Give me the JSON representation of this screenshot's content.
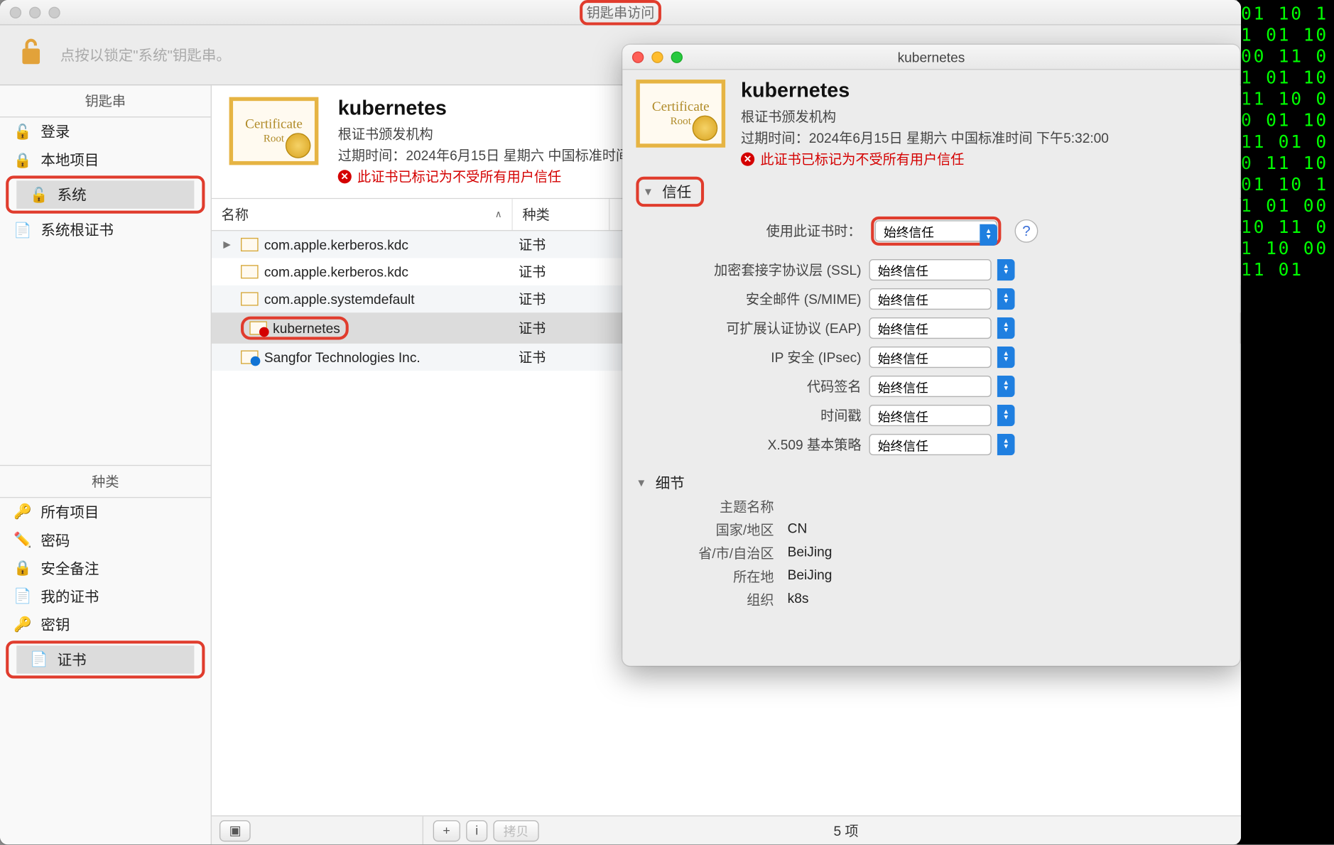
{
  "window": {
    "title": "钥匙串访问",
    "lock_hint": "点按以锁定\"系统\"钥匙串。"
  },
  "sidebar": {
    "keychains": {
      "header": "钥匙串",
      "items": [
        {
          "label": "登录",
          "icon": "🔓"
        },
        {
          "label": "本地项目",
          "icon": "🔒"
        },
        {
          "label": "系统",
          "icon": "🔓",
          "selected": true,
          "highlight": true
        },
        {
          "label": "系统根证书",
          "icon": "📄"
        }
      ]
    },
    "categories": {
      "header": "种类",
      "items": [
        {
          "label": "所有项目",
          "icon": "🔑"
        },
        {
          "label": "密码",
          "icon": "✏️"
        },
        {
          "label": "安全备注",
          "icon": "🔒"
        },
        {
          "label": "我的证书",
          "icon": "📄"
        },
        {
          "label": "密钥",
          "icon": "🔑"
        },
        {
          "label": "证书",
          "icon": "📄",
          "selected": true,
          "highlight": true
        }
      ]
    }
  },
  "cert_header": {
    "title": "kubernetes",
    "subtitle": "根证书颁发机构",
    "expiry": "过期时间：2024年6月15日 星期六 中国标准时间 下午5:32:00",
    "error": "此证书已标记为不受所有用户信任"
  },
  "columns": {
    "name": "名称",
    "kind": "种类"
  },
  "rows": [
    {
      "name": "com.apple.kerberos.kdc",
      "kind": "证书",
      "expand": true
    },
    {
      "name": "com.apple.kerberos.kdc",
      "kind": "证书"
    },
    {
      "name": "com.apple.systemdefault",
      "kind": "证书"
    },
    {
      "name": "kubernetes",
      "kind": "证书",
      "selected": true,
      "highlight": true,
      "badge": "red"
    },
    {
      "name": "Sangfor Technologies Inc.",
      "kind": "证书",
      "badge": "blue"
    }
  ],
  "statusbar": {
    "copy": "拷贝",
    "count": "5 项",
    "plus": "+",
    "info": "i"
  },
  "detail": {
    "title": "kubernetes",
    "trust_section": "信任",
    "details_section": "细节",
    "use_label": "使用此证书时：",
    "trust_value": "始终信任",
    "trust_rows": [
      {
        "label": "加密套接字协议层 (SSL)",
        "value": "始终信任"
      },
      {
        "label": "安全邮件 (S/MIME)",
        "value": "始终信任"
      },
      {
        "label": "可扩展认证协议 (EAP)",
        "value": "始终信任"
      },
      {
        "label": "IP 安全 (IPsec)",
        "value": "始终信任"
      },
      {
        "label": "代码签名",
        "value": "始终信任"
      },
      {
        "label": "时间戳",
        "value": "始终信任"
      },
      {
        "label": "X.509 基本策略",
        "value": "始终信任"
      }
    ],
    "subject_heading": "主题名称",
    "kv": [
      {
        "k": "国家/地区",
        "v": "CN"
      },
      {
        "k": "省/市/自治区",
        "v": "BeiJing"
      },
      {
        "k": "所在地",
        "v": "BeiJing"
      },
      {
        "k": "组织",
        "v": "k8s"
      }
    ]
  }
}
